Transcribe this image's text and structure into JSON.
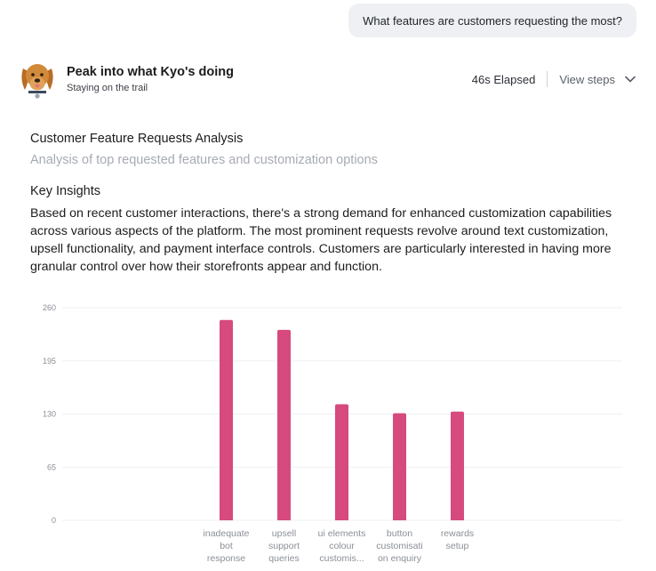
{
  "user_message": "What features are customers requesting the most?",
  "agent": {
    "name": "Peak into what Kyo's doing",
    "status": "Staying on the trail",
    "elapsed": "46s Elapsed",
    "view_steps": "View steps"
  },
  "report": {
    "title": "Customer Feature Requests Analysis",
    "subtitle": "Analysis of top requested features and customization options",
    "insights_heading": "Key Insights",
    "insights_body": "Based on recent customer interactions, there's a strong demand for enhanced customization capabilities across various aspects of the platform. The most prominent requests revolve around text customization, upsell functionality, and payment interface controls. Customers are particularly interested in having more granular control over how their storefronts appear and function."
  },
  "colors": {
    "bar": "#d64a7e",
    "grid": "#eef0f2",
    "avatar_fur": "#d08a3a"
  },
  "chart_data": {
    "type": "bar",
    "categories": [
      "inadequate bot response",
      "upsell support queries",
      "ui elements colour customis...",
      "button customisati on enquiry",
      "rewards setup"
    ],
    "category_label_lines": [
      [
        "inadequate",
        "bot",
        "response"
      ],
      [
        "upsell",
        "support",
        "queries"
      ],
      [
        "ui elements",
        "colour",
        "customis..."
      ],
      [
        "button",
        "customisati",
        "on enquiry"
      ],
      [
        "rewards",
        "setup"
      ]
    ],
    "values": [
      245,
      233,
      142,
      131,
      133
    ],
    "y_ticks": [
      "0",
      "65",
      "130",
      "195",
      "260"
    ],
    "ylim": [
      0,
      260
    ],
    "grid": true,
    "xlabel": "",
    "ylabel": ""
  }
}
